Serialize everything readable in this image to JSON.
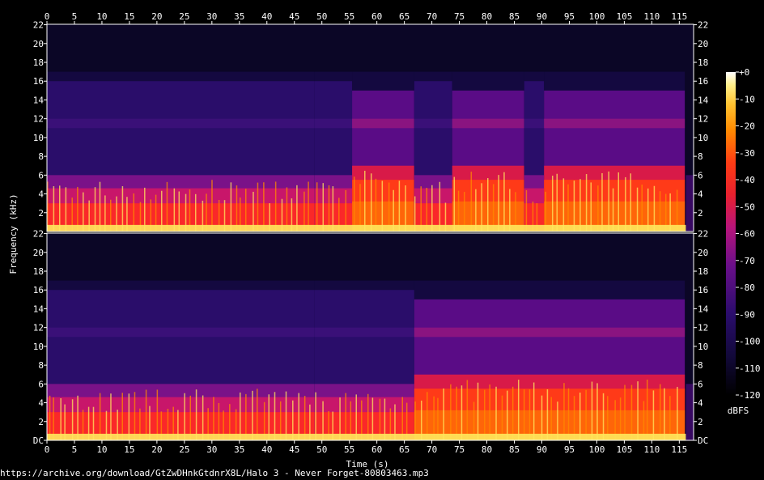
{
  "chart_data": {
    "type": "heatmap",
    "xlabel": "Time (s)",
    "ylabel": "Frequency (kHz)",
    "x_ticks": [
      0,
      5,
      10,
      15,
      20,
      25,
      30,
      35,
      40,
      45,
      50,
      55,
      60,
      65,
      70,
      75,
      80,
      85,
      90,
      95,
      100,
      105,
      110,
      115
    ],
    "xlim": [
      0,
      117.6
    ],
    "channels": [
      {
        "y_ticks": [
          "22",
          "20",
          "18",
          "16",
          "14",
          "12",
          "10",
          "8",
          "6",
          "4",
          "2"
        ],
        "ylim": [
          0,
          22.05
        ],
        "segments": [
          {
            "start": 0,
            "end": 48.7,
            "cutoff_khz": 16,
            "level": "moderate"
          },
          {
            "start": 48.7,
            "end": 55.5,
            "cutoff_khz": 16,
            "level": "moderate"
          },
          {
            "start": 55.5,
            "end": 66.8,
            "cutoff_khz": 15,
            "level": "high"
          },
          {
            "start": 66.8,
            "end": 73.7,
            "cutoff_khz": 16,
            "level": "moderate"
          },
          {
            "start": 73.7,
            "end": 86.8,
            "cutoff_khz": 15,
            "level": "high"
          },
          {
            "start": 86.8,
            "end": 90.4,
            "cutoff_khz": 16,
            "level": "moderate"
          },
          {
            "start": 90.4,
            "end": 116.0,
            "cutoff_khz": 15,
            "level": "high"
          }
        ]
      },
      {
        "y_ticks": [
          "22",
          "20",
          "18",
          "16",
          "14",
          "12",
          "10",
          "8",
          "6",
          "4",
          "2",
          "DC"
        ],
        "ylim": [
          0,
          22.05
        ],
        "segments": [
          {
            "start": 0,
            "end": 48.7,
            "cutoff_khz": 16,
            "level": "moderate"
          },
          {
            "start": 48.7,
            "end": 66.8,
            "cutoff_khz": 16,
            "level": "moderate"
          },
          {
            "start": 66.8,
            "end": 116.0,
            "cutoff_khz": 15,
            "level": "high"
          }
        ]
      }
    ],
    "colorbar": {
      "label": "dBFS",
      "ticks": [
        "+0",
        "-10",
        "-20",
        "-30",
        "-40",
        "-50",
        "-60",
        "-70",
        "-80",
        "-90",
        "-100",
        "-110",
        "-120"
      ],
      "range": [
        -120,
        0
      ]
    }
  },
  "footer_text": "https://archive.org/download/GtZwDHnkGtdnrX8L/Halo 3 - Never Forget-80803463.mp3",
  "colors": {
    "background": "#000000",
    "text": "#ffffff",
    "floor": "#0b0626",
    "deep_blue": "#1c0d52",
    "purple": "#6a0f8a",
    "magenta": "#b8147a",
    "red": "#ff2a1e",
    "orange": "#ff8a00",
    "yellow": "#ffe85c",
    "white": "#ffffff"
  }
}
